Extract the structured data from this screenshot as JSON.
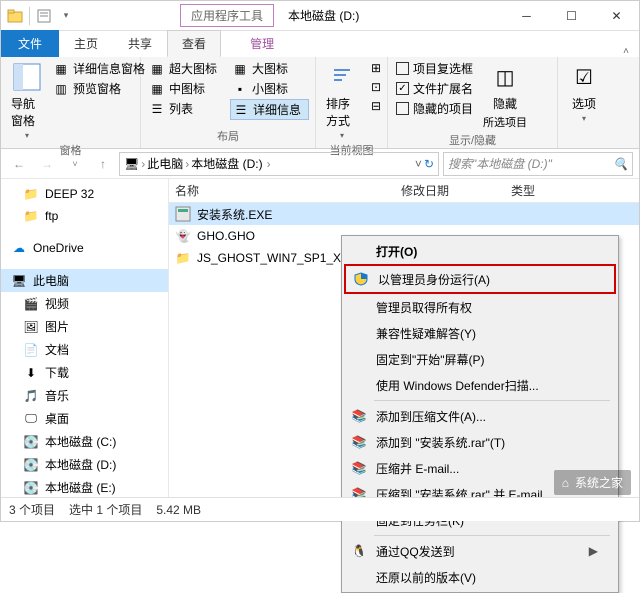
{
  "window": {
    "context_tab": "应用程序工具",
    "title": "本地磁盘 (D:)"
  },
  "tabs": {
    "file": "文件",
    "home": "主页",
    "share": "共享",
    "view": "查看",
    "manage": "管理"
  },
  "ribbon": {
    "panes": {
      "nav_pane": "导航窗格",
      "preview_pane": "预览窗格",
      "detail_pane": "详细信息窗格",
      "title": "窗格"
    },
    "layout": {
      "extra_large": "超大图标",
      "large": "大图标",
      "medium": "中图标",
      "small": "小图标",
      "list": "列表",
      "details": "详细信息",
      "title": "布局"
    },
    "current": {
      "sort": "排序方式",
      "title": "当前视图"
    },
    "showhide": {
      "checkboxes": "项目复选框",
      "extensions": "文件扩展名",
      "hidden_items": "隐藏的项目",
      "hide": "隐藏",
      "selected": "所选项目",
      "title": "显示/隐藏"
    },
    "options": "选项"
  },
  "address": {
    "root": "此电脑",
    "drive": "本地磁盘 (D:)"
  },
  "search": {
    "placeholder": "搜索\"本地磁盘 (D:)\""
  },
  "nav": {
    "deep32": "DEEP 32",
    "ftp": "ftp",
    "onedrive": "OneDrive",
    "thispc": "此电脑",
    "videos": "视频",
    "pictures": "图片",
    "documents": "文档",
    "downloads": "下载",
    "music": "音乐",
    "desktop": "桌面",
    "disk_c": "本地磁盘 (C:)",
    "disk_d": "本地磁盘 (D:)",
    "disk_e": "本地磁盘 (E:)"
  },
  "columns": {
    "name": "名称",
    "date": "修改日期",
    "type": "类型"
  },
  "files": [
    {
      "name": "安装系统.EXE",
      "icon": "exe"
    },
    {
      "name": "GHO.GHO",
      "icon": "gho"
    },
    {
      "name": "JS_GHOST_WIN7_SP1_X64_",
      "icon": "folder"
    }
  ],
  "context_menu": {
    "open": "打开(O)",
    "run_admin": "以管理员身份运行(A)",
    "take_ownership": "管理员取得所有权",
    "troubleshoot": "兼容性疑难解答(Y)",
    "pin_start": "固定到\"开始\"屏幕(P)",
    "defender": "使用 Windows Defender扫描...",
    "add_archive": "添加到压缩文件(A)...",
    "add_rar": "添加到 \"安装系统.rar\"(T)",
    "compress_email": "压缩并 E-mail...",
    "compress_rar_email": "压缩到 \"安装系统.rar\" 并 E-mail",
    "pin_taskbar": "固定到任务栏(K)",
    "qq_send": "通过QQ发送到",
    "restore_prev": "还原以前的版本(V)"
  },
  "status": {
    "count": "3 个项目",
    "selected": "选中 1 个项目",
    "size": "5.42 MB"
  },
  "watermark": "系统之家"
}
